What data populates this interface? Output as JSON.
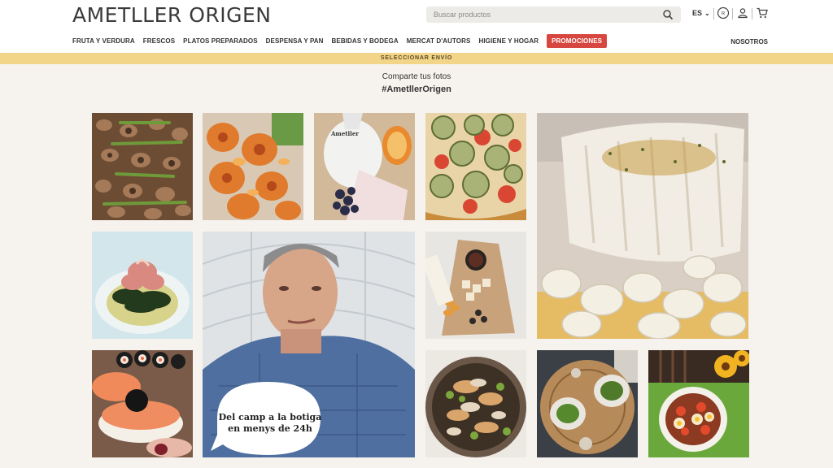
{
  "header": {
    "logo": "AMETLLER ORIGEN",
    "search_placeholder": "Buscar productos",
    "language": "ES"
  },
  "nav": {
    "items": [
      "FRUTA Y VERDURA",
      "FRESCOS",
      "PLATOS PREPARADOS",
      "DESPENSA Y PAN",
      "BEBIDAS Y BODEGA",
      "MERCAT D'AUTORS",
      "HIGIENE Y HOGAR",
      "PROMOCIONES"
    ],
    "right": "NOSOTROS"
  },
  "shipping_bar": "SELECCIONAR ENVÍO",
  "gallery": {
    "line1": "Comparte tus fotos",
    "line2": "#AmetllerOrigen",
    "bag_label": "Ametller",
    "video_caption_line1": "Del camp a la botiga",
    "video_caption_line2": "en menys de 24h"
  },
  "colors": {
    "promo": "#d8473f",
    "ship_bar": "#f3d58a",
    "page_bg": "#f6f3ee"
  }
}
